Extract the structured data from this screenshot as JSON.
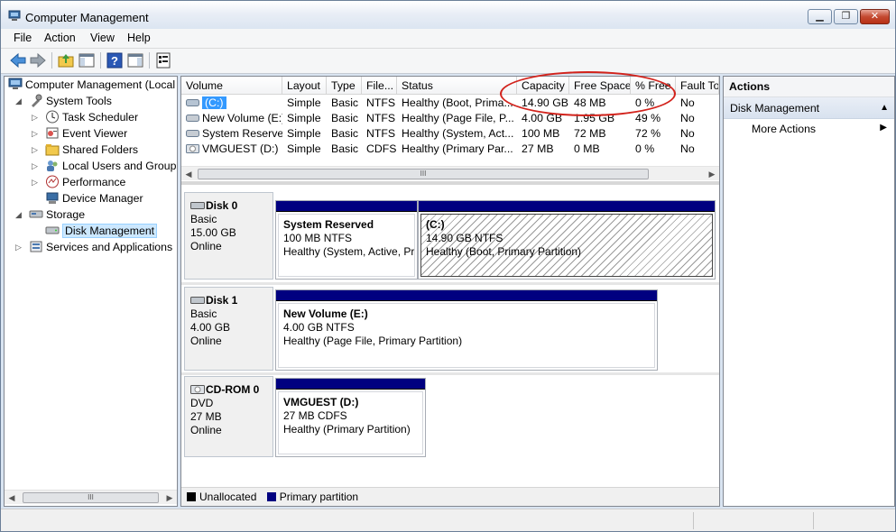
{
  "window": {
    "title": "Computer Management",
    "buttons": [
      "minimize",
      "restore",
      "close"
    ]
  },
  "menu": [
    "File",
    "Action",
    "View",
    "Help"
  ],
  "toolbar": {
    "buttons": [
      "back-icon",
      "forward-icon",
      "up-folder-icon",
      "show-hide-tree-icon",
      "help-icon",
      "show-hide-action-pane-icon",
      "properties-icon"
    ]
  },
  "tree": {
    "items": [
      {
        "label": "Computer Management (Local",
        "icon": "computer-management-icon",
        "level": 0,
        "expander": ""
      },
      {
        "label": "System Tools",
        "icon": "tools-icon",
        "level": 1,
        "expander": "◢"
      },
      {
        "label": "Task Scheduler",
        "icon": "clock-icon",
        "level": 2,
        "expander": "▷"
      },
      {
        "label": "Event Viewer",
        "icon": "event-viewer-icon",
        "level": 2,
        "expander": "▷"
      },
      {
        "label": "Shared Folders",
        "icon": "shared-folder-icon",
        "level": 2,
        "expander": "▷"
      },
      {
        "label": "Local Users and Groups",
        "icon": "users-icon",
        "level": 2,
        "expander": "▷"
      },
      {
        "label": "Performance",
        "icon": "performance-icon",
        "level": 2,
        "expander": "▷"
      },
      {
        "label": "Device Manager",
        "icon": "device-manager-icon",
        "level": 2,
        "expander": ""
      },
      {
        "label": "Storage",
        "icon": "storage-icon",
        "level": 1,
        "expander": "◢"
      },
      {
        "label": "Disk Management",
        "icon": "disk-management-icon",
        "level": 2,
        "expander": "",
        "selected": true
      },
      {
        "label": "Services and Applications",
        "icon": "services-icon",
        "level": 1,
        "expander": "▷"
      }
    ]
  },
  "volumes": {
    "columns": [
      "Volume",
      "Layout",
      "Type",
      "File...",
      "Status",
      "Capacity",
      "Free Space",
      "% Free",
      "Fault To"
    ],
    "rows": [
      {
        "volume": "(C:)",
        "layout": "Simple",
        "type": "Basic",
        "fs": "NTFS",
        "status": "Healthy (Boot, Prima...",
        "capacity": "14.90 GB",
        "free": "48 MB",
        "pct": "0 %",
        "fault": "No",
        "selected": true,
        "icon": "drive-icon"
      },
      {
        "volume": "New Volume (E:)",
        "layout": "Simple",
        "type": "Basic",
        "fs": "NTFS",
        "status": "Healthy (Page File, P...",
        "capacity": "4.00 GB",
        "free": "1.95 GB",
        "pct": "49 %",
        "fault": "No",
        "icon": "drive-icon"
      },
      {
        "volume": "System Reserved",
        "layout": "Simple",
        "type": "Basic",
        "fs": "NTFS",
        "status": "Healthy (System, Act...",
        "capacity": "100 MB",
        "free": "72 MB",
        "pct": "72 %",
        "fault": "No",
        "icon": "drive-icon"
      },
      {
        "volume": "VMGUEST (D:)",
        "layout": "Simple",
        "type": "Basic",
        "fs": "CDFS",
        "status": "Healthy (Primary Par...",
        "capacity": "27 MB",
        "free": "0 MB",
        "pct": "0 %",
        "fault": "No",
        "icon": "cdrom-icon"
      }
    ]
  },
  "disks": [
    {
      "name": "Disk 0",
      "kind": "Basic",
      "size": "15.00 GB",
      "state": "Online",
      "icon": "disk-icon",
      "partitions": [
        {
          "name": "System Reserved",
          "size": "100 MB NTFS",
          "status": "Healthy (System, Active, Pr",
          "hatched": false
        },
        {
          "name": "(C:)",
          "size": "14.90 GB NTFS",
          "status": "Healthy (Boot, Primary Partition)",
          "hatched": true
        }
      ]
    },
    {
      "name": "Disk 1",
      "kind": "Basic",
      "size": "4.00 GB",
      "state": "Online",
      "icon": "disk-icon",
      "partitions": [
        {
          "name": "New Volume  (E:)",
          "size": "4.00 GB NTFS",
          "status": "Healthy (Page File, Primary Partition)",
          "hatched": false
        }
      ]
    },
    {
      "name": "CD-ROM 0",
      "kind": "DVD",
      "size": "27 MB",
      "state": "Online",
      "icon": "cdrom-icon",
      "partitions": [
        {
          "name": "VMGUEST  (D:)",
          "size": "27 MB CDFS",
          "status": "Healthy (Primary Partition)",
          "hatched": false
        }
      ]
    }
  ],
  "legend": [
    {
      "label": "Unallocated",
      "color": "#000000"
    },
    {
      "label": "Primary partition",
      "color": "#000080"
    }
  ],
  "actions": {
    "header": "Actions",
    "section": "Disk Management",
    "items": [
      "More Actions"
    ]
  },
  "colors": {
    "selection": "#3399ff",
    "primary_partition": "#000080",
    "highlight_oval": "#d2231c"
  }
}
